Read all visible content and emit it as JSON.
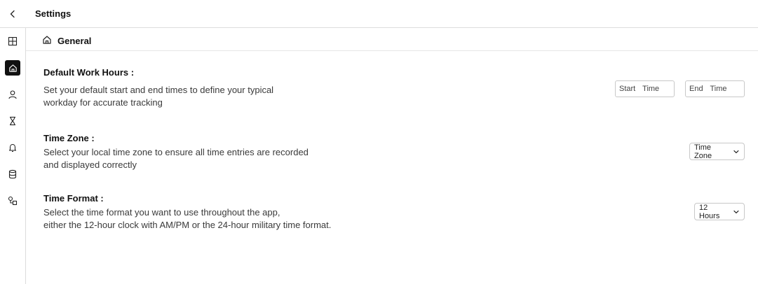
{
  "header": {
    "title": "Settings",
    "back_icon": "chevron-left-icon"
  },
  "sidebar": {
    "items": [
      {
        "name": "dashboard",
        "icon": "grid-icon",
        "active": false
      },
      {
        "name": "general",
        "icon": "home-icon",
        "active": true
      },
      {
        "name": "profile",
        "icon": "user-icon",
        "active": false
      },
      {
        "name": "timer",
        "icon": "hourglass-icon",
        "active": false
      },
      {
        "name": "notifications",
        "icon": "bell-icon",
        "active": false
      },
      {
        "name": "data",
        "icon": "database-icon",
        "active": false
      },
      {
        "name": "integrations",
        "icon": "shapes-icon",
        "active": false
      }
    ],
    "active_color": "#111111"
  },
  "section": {
    "icon": "home-icon",
    "title": "General"
  },
  "settings": {
    "work_hours": {
      "title": "Default Work Hours :",
      "desc_line1": "Set your default start and end times to define your typical",
      "desc_line2": "workday for accurate tracking",
      "start_placeholder": "Start  Time",
      "end_placeholder": "End  Time"
    },
    "time_zone": {
      "title": "Time Zone :",
      "desc_line1": "Select your local time zone to ensure all time entries are recorded",
      "desc_line2": "and displayed correctly",
      "select_value": "Time Zone"
    },
    "time_format": {
      "title": "Time Format :",
      "desc_line1": "Select the time format you want to use throughout the app,",
      "desc_line2": "either the 12-hour clock with AM/PM or the 24-hour military time format.",
      "select_value": "12 Hours"
    }
  }
}
